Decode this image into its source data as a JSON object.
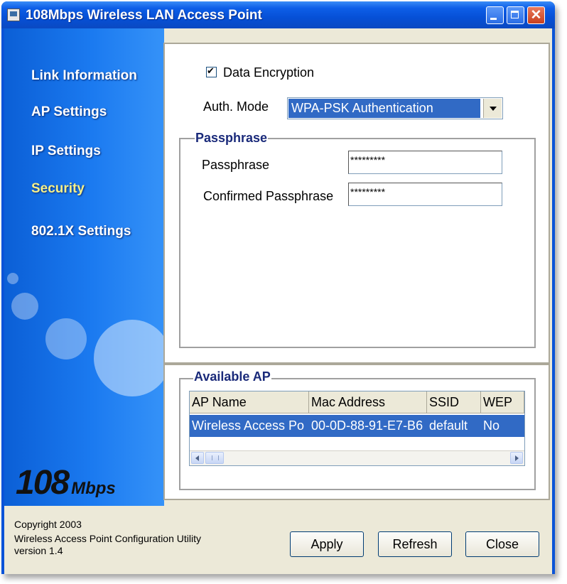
{
  "window": {
    "title": "108Mbps Wireless LAN Access Point",
    "buttons": {
      "close_glyph": "✕"
    }
  },
  "sidebar": {
    "items": [
      {
        "label": "Link Information"
      },
      {
        "label": "AP Settings"
      },
      {
        "label": "IP Settings"
      },
      {
        "label": "Security",
        "active": true
      },
      {
        "label": "802.1X Settings"
      }
    ],
    "logo_big": "108",
    "logo_small": "Mbps"
  },
  "security": {
    "data_encryption_label": "Data Encryption",
    "data_encryption_checked": true,
    "check_glyph": "✔",
    "auth_mode_label": "Auth. Mode",
    "auth_mode_value": "WPA-PSK Authentication",
    "passphrase_group": "Passphrase",
    "passphrase_label": "Passphrase",
    "passphrase_value": "*********",
    "confirm_label": "Confirmed Passphrase",
    "confirm_value": "*********"
  },
  "available_ap": {
    "group_label": "Available AP",
    "columns": [
      "AP Name",
      "Mac Address",
      "SSID",
      "WEP"
    ],
    "rows": [
      [
        "Wireless Access Po",
        "00-0D-88-91-E7-B6",
        "default",
        "No"
      ]
    ]
  },
  "footer": {
    "line1": "Copyright 2003",
    "line2": "Wireless Access Point Configuration Utility",
    "line3": "version 1.4"
  },
  "buttons": {
    "apply": "Apply",
    "refresh": "Refresh",
    "close": "Close"
  },
  "colors": {
    "titlebar": "#0a53d8",
    "selection": "#316ac5",
    "active_nav": "#f5f08a"
  }
}
